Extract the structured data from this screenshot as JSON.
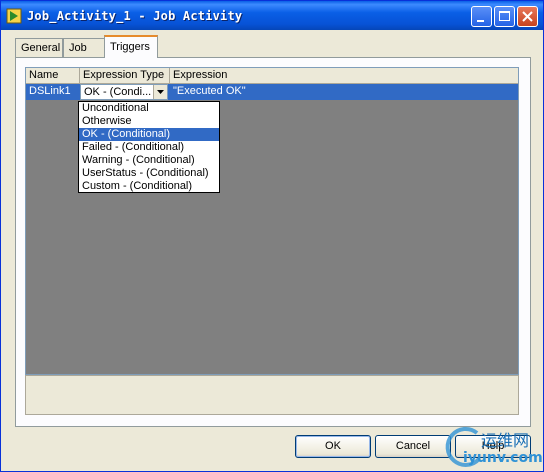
{
  "window": {
    "title": "Job_Activity_1 - Job Activity",
    "controls": [
      "minimize-icon",
      "maximize-icon",
      "close-icon"
    ]
  },
  "tabs": [
    {
      "label": "General",
      "active": false
    },
    {
      "label": "Job",
      "active": false
    },
    {
      "label": "Triggers",
      "active": true
    }
  ],
  "grid": {
    "columns": [
      "Name",
      "Expression Type",
      "Expression"
    ],
    "rows": [
      {
        "name": "DSLink1",
        "expression_type": "OK - (Condi...",
        "expression": "\"Executed OK\""
      }
    ]
  },
  "dropdown": {
    "options": [
      "Unconditional",
      "Otherwise",
      "OK - (Conditional)",
      "Failed - (Conditional)",
      "Warning - (Conditional)",
      "UserStatus - (Conditional)",
      "Custom - (Conditional)"
    ],
    "selected_index": 2
  },
  "buttons": {
    "ok": "OK",
    "cancel": "Cancel",
    "help": "Help"
  },
  "watermark": {
    "text": "运维网",
    "url": "iyunv.com"
  },
  "colors": {
    "title_bar": "#0a5fe6",
    "selection": "#316ac5",
    "grid_background": "#808080",
    "dialog_background": "#ece9d8"
  }
}
